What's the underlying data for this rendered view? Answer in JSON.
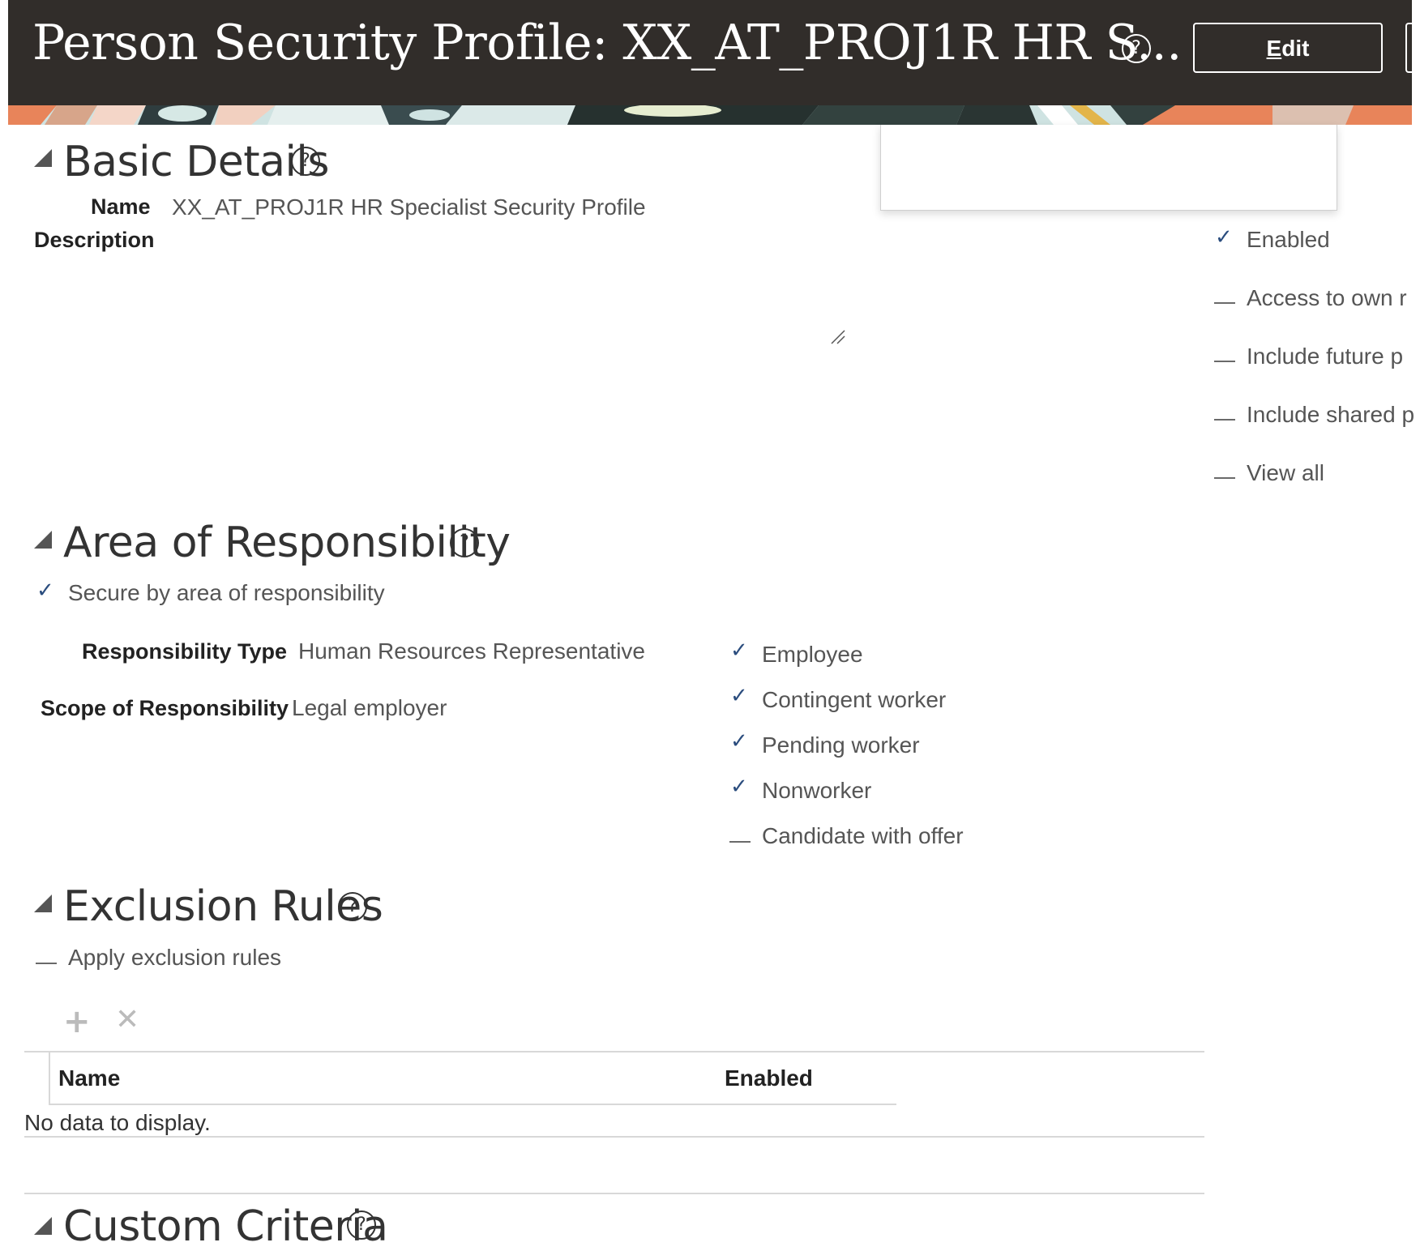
{
  "header": {
    "title": "Person Security Profile: XX_AT_PROJ1R HR S...",
    "help_icon": "question-circle-icon",
    "edit_label_underlined": "E",
    "edit_label_rest": "dit",
    "background": "#312d2a"
  },
  "basic_details": {
    "title": "Basic Details",
    "name_label": "Name",
    "name_value": "XX_AT_PROJ1R HR Specialist Security Profile",
    "description_label": "Description",
    "options": [
      {
        "label": "Enabled",
        "checked": true
      },
      {
        "label": "Access to own r",
        "checked": false
      },
      {
        "label": "Include future p",
        "checked": false
      },
      {
        "label": "Include shared p",
        "checked": false
      },
      {
        "label": "View all",
        "checked": false
      }
    ]
  },
  "area_of_responsibility": {
    "title": "Area of Responsibility",
    "secure_label": "Secure by area of responsibility",
    "secure_checked": true,
    "responsibility_type_label": "Responsibility Type",
    "responsibility_type_value": "Human Resources Representative",
    "scope_label": "Scope of Responsibility",
    "scope_value": "Legal employer",
    "worker_types": [
      {
        "label": "Employee",
        "checked": true
      },
      {
        "label": "Contingent worker",
        "checked": true
      },
      {
        "label": "Pending worker",
        "checked": true
      },
      {
        "label": "Nonworker",
        "checked": true
      },
      {
        "label": "Candidate with offer",
        "checked": false
      }
    ]
  },
  "exclusion_rules": {
    "title": "Exclusion Rules",
    "apply_label": "Apply exclusion rules",
    "apply_checked": false,
    "toolbar": {
      "add_icon": "plus-icon",
      "delete_icon": "x-icon"
    },
    "columns": [
      "Name",
      "Enabled"
    ],
    "empty_text": "No data to display."
  },
  "custom_criteria": {
    "title": "Custom Criteria"
  },
  "colors": {
    "check": "#2b4d7e",
    "text_value": "#555555",
    "label": "#222222"
  }
}
